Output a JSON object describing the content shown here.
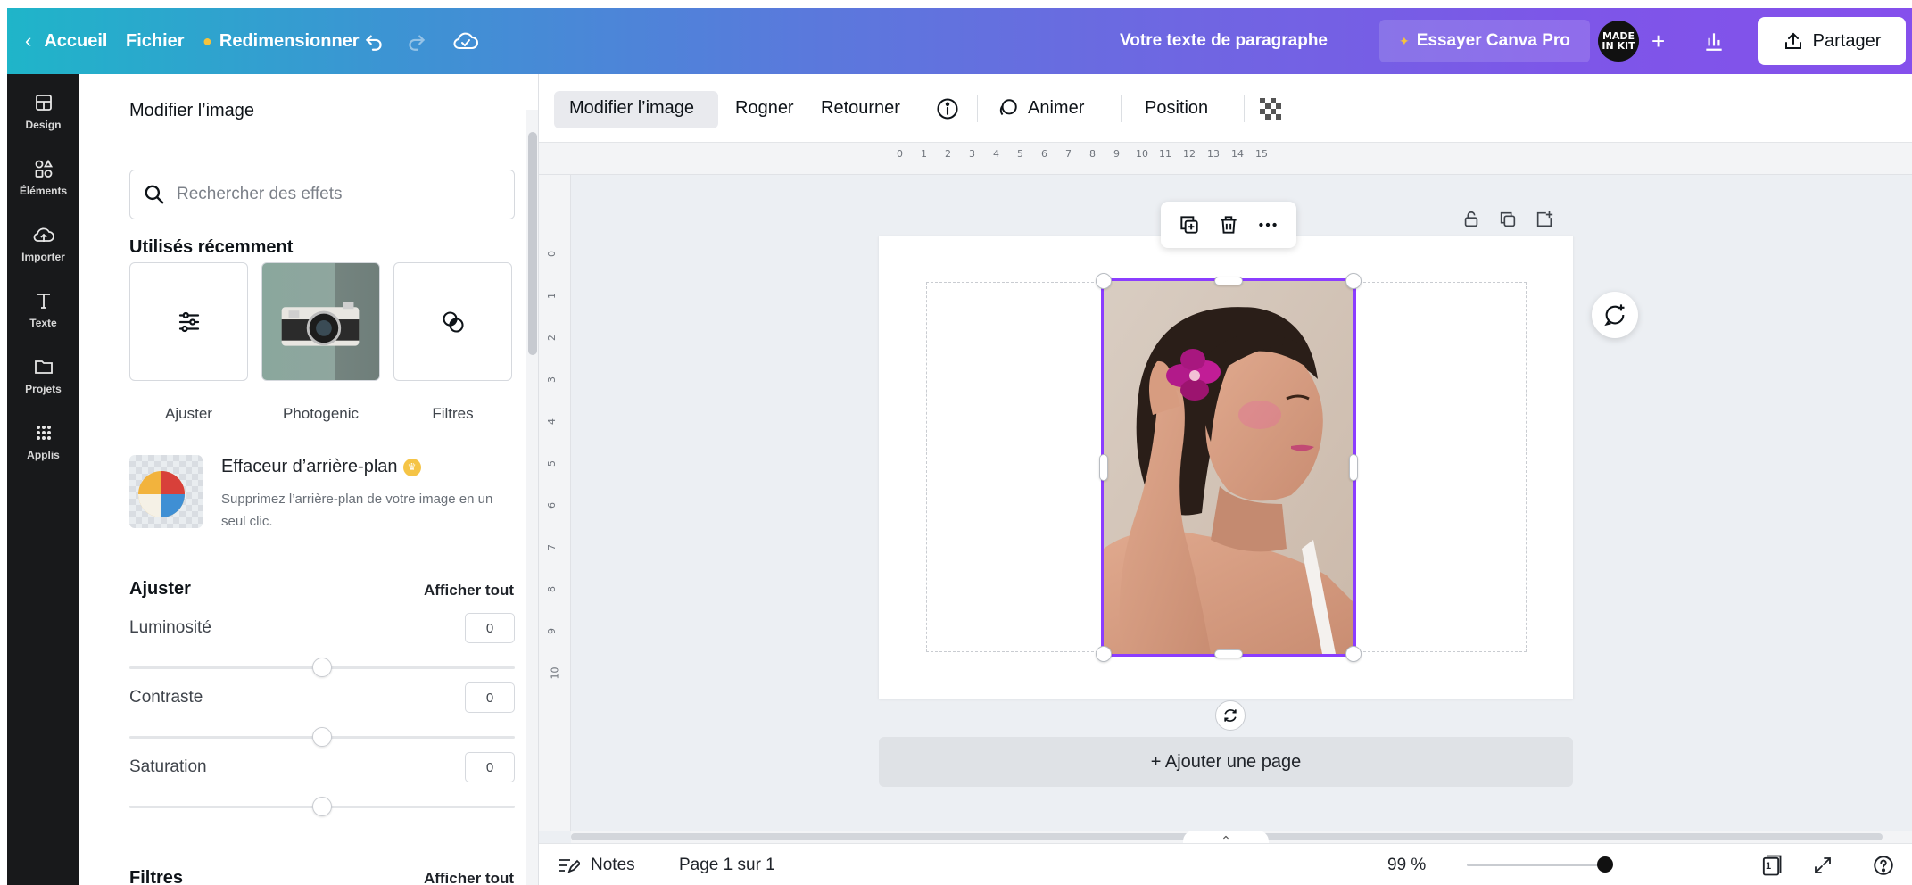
{
  "topbar": {
    "home_label": "Accueil",
    "file_label": "Fichier",
    "resize_label": "Redimensionner",
    "doc_title": "Votre texte de paragraphe",
    "pro_label": "Essayer Canva Pro",
    "avatar_text_1": "MADE",
    "avatar_text_2": "IN KIT",
    "plus_label": "+",
    "share_label": "Partager"
  },
  "rail": {
    "items": [
      {
        "label": "Design",
        "icon": "layout-icon"
      },
      {
        "label": "Éléments",
        "icon": "shapes-icon"
      },
      {
        "label": "Importer",
        "icon": "cloud-upload-icon"
      },
      {
        "label": "Texte",
        "icon": "text-icon"
      },
      {
        "label": "Projets",
        "icon": "folder-icon"
      },
      {
        "label": "Applis",
        "icon": "apps-grid-icon"
      }
    ]
  },
  "panel": {
    "title": "Modifier l’image",
    "search_placeholder": "Rechercher des effets",
    "recent_heading": "Utilisés récemment",
    "recent": [
      {
        "label": "Ajuster",
        "icon": "sliders-icon"
      },
      {
        "label": "Photogenic",
        "icon": "camera-photo"
      },
      {
        "label": "Filtres",
        "icon": "filter-circles-icon"
      }
    ],
    "bg_remover": {
      "title": "Effaceur d’arrière-plan",
      "description": "Supprimez l’arrière-plan de votre image en un seul clic."
    },
    "adjust_heading": "Ajuster",
    "adjust_see_all": "Afficher tout",
    "sliders": [
      {
        "label": "Luminosité",
        "value": "0",
        "level": 0.0
      },
      {
        "label": "Contraste",
        "value": "0",
        "level": 0.0
      },
      {
        "label": "Saturation",
        "value": "0",
        "level": 0.0
      }
    ],
    "filters_heading": "Filtres",
    "filters_see_all": "Afficher tout"
  },
  "context_toolbar": {
    "edit_image": "Modifier l’image",
    "crop": "Rogner",
    "flip": "Retourner",
    "animate": "Animer",
    "position": "Position"
  },
  "rulers": {
    "top": [
      "0",
      "1",
      "2",
      "3",
      "4",
      "5",
      "6",
      "7",
      "8",
      "9",
      "10",
      "11",
      "12",
      "13",
      "14",
      "15"
    ],
    "left": [
      "0",
      "1",
      "2",
      "3",
      "4",
      "5",
      "6",
      "7",
      "8",
      "9",
      "10"
    ]
  },
  "canvas": {
    "add_page_label": "+ Ajouter une page"
  },
  "bottombar": {
    "notes_label": "Notes",
    "page_label": "Page 1 sur 1",
    "zoom_label": "99 %",
    "zoom_level": 0.99,
    "page_count": "1"
  },
  "colors": {
    "accent": "#8b3dff",
    "rail_bg": "#18191b",
    "pro_crown": "#f6c33c"
  }
}
